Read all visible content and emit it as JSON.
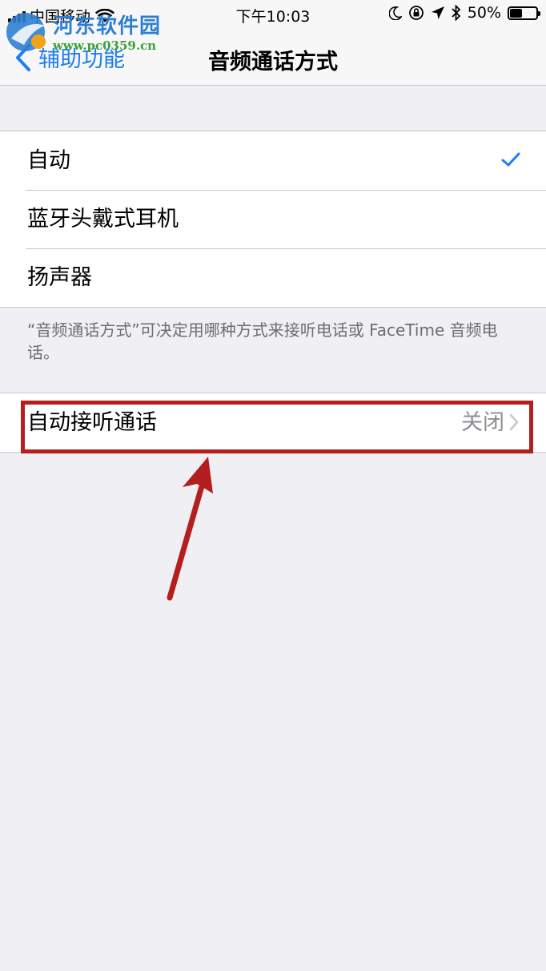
{
  "status_bar": {
    "carrier": "中国移动",
    "time": "下午10:03",
    "battery_percent": "50%",
    "battery_level": 0.5
  },
  "nav": {
    "back_label": "辅助功能",
    "title": "音频通话方式"
  },
  "watermark": {
    "name": "河东软件园",
    "url": "www.pc0359.cn"
  },
  "options": {
    "items": [
      {
        "label": "自动",
        "selected": true
      },
      {
        "label": "蓝牙头戴式耳机",
        "selected": false
      },
      {
        "label": "扬声器",
        "selected": false
      }
    ],
    "footer": "“音频通话方式”可决定用哪种方式来接听电话或 FaceTime 音频电话。"
  },
  "auto_answer": {
    "label": "自动接听通话",
    "value": "关闭"
  },
  "colors": {
    "accent": "#1f7cf5",
    "annotation": "#b41e1e",
    "background": "#efeff4"
  }
}
